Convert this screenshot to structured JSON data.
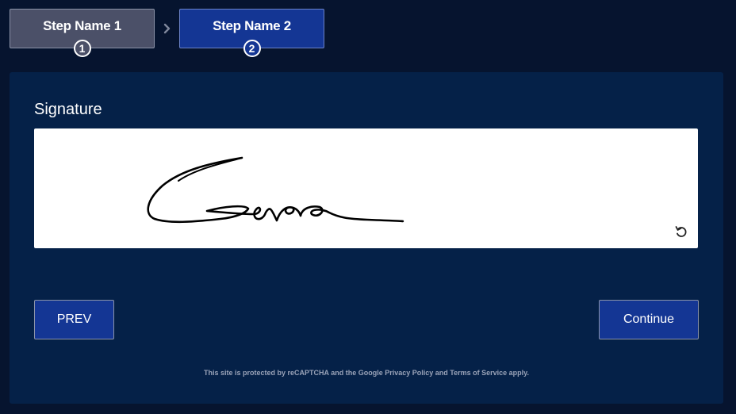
{
  "steps": [
    {
      "label": "Step Name 1",
      "number": "1",
      "state": "completed"
    },
    {
      "label": "Step Name 2",
      "number": "2",
      "state": "active"
    }
  ],
  "signature": {
    "label": "Signature"
  },
  "buttons": {
    "prev": "PREV",
    "continue": "Continue"
  },
  "footer": {
    "recaptcha_notice": "This site is protected by reCAPTCHA and the Google Privacy Policy and Terms of Service apply."
  },
  "icons": {
    "step_separator": "chevron-right-icon",
    "signature_reset": "undo-icon"
  },
  "colors": {
    "page_background": "#06142f",
    "panel_background": "#052148",
    "active_step": "#143694",
    "completed_step": "#4b5068",
    "button_background": "#143694",
    "text": "#ffffff"
  }
}
